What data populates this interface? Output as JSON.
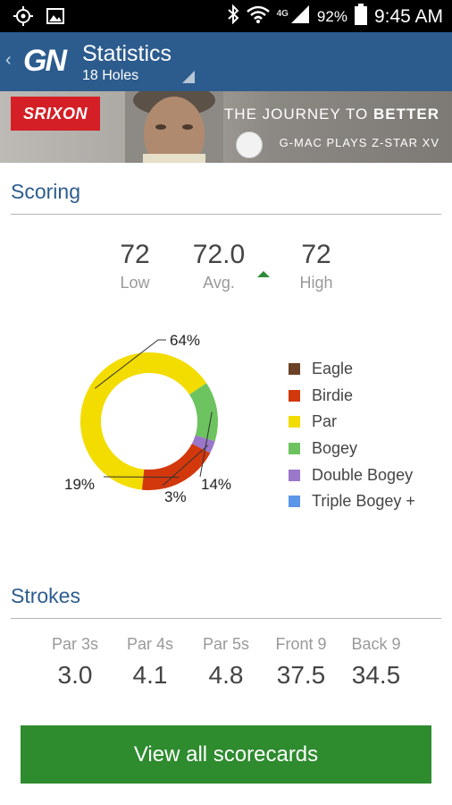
{
  "status_bar": {
    "battery": "92%",
    "time": "9:45 AM",
    "network": "4G",
    "icons": [
      "gps-icon",
      "image-icon",
      "bluetooth-icon",
      "wifi-icon",
      "signal-icon",
      "battery-icon"
    ]
  },
  "app_bar": {
    "logo": "GN",
    "title": "Statistics",
    "subtitle": "18 Holes",
    "back_icon": "‹"
  },
  "ad": {
    "brand": "SRIXON",
    "tagline_prefix": "THE JOURNEY TO ",
    "tagline_bold": "BETTER",
    "subline": "G-MAC PLAYS Z-STAR XV"
  },
  "scoring": {
    "title": "Scoring",
    "low": {
      "value": "72",
      "label": "Low"
    },
    "avg": {
      "value": "72.0",
      "label": "Avg."
    },
    "high": {
      "value": "72",
      "label": "High"
    }
  },
  "chart_data": {
    "type": "pie",
    "donut": true,
    "categories": [
      "Eagle",
      "Birdie",
      "Par",
      "Bogey",
      "Double Bogey",
      "Triple Bogey +"
    ],
    "values": [
      0,
      19,
      64,
      14,
      3,
      0
    ],
    "labels": [
      "",
      "19%",
      "64%",
      "14%",
      "3%",
      ""
    ],
    "colors": [
      "#6b4226",
      "#d2380c",
      "#f3dc00",
      "#6cc35f",
      "#9a77c9",
      "#5b96e8"
    ],
    "legend_position": "right"
  },
  "strokes": {
    "title": "Strokes",
    "items": [
      {
        "label": "Par 3s",
        "value": "3.0"
      },
      {
        "label": "Par 4s",
        "value": "4.1"
      },
      {
        "label": "Par 5s",
        "value": "4.8"
      },
      {
        "label": "Front 9",
        "value": "37.5"
      },
      {
        "label": "Back 9",
        "value": "34.5"
      }
    ]
  },
  "cta": {
    "label": "View all scorecards"
  }
}
